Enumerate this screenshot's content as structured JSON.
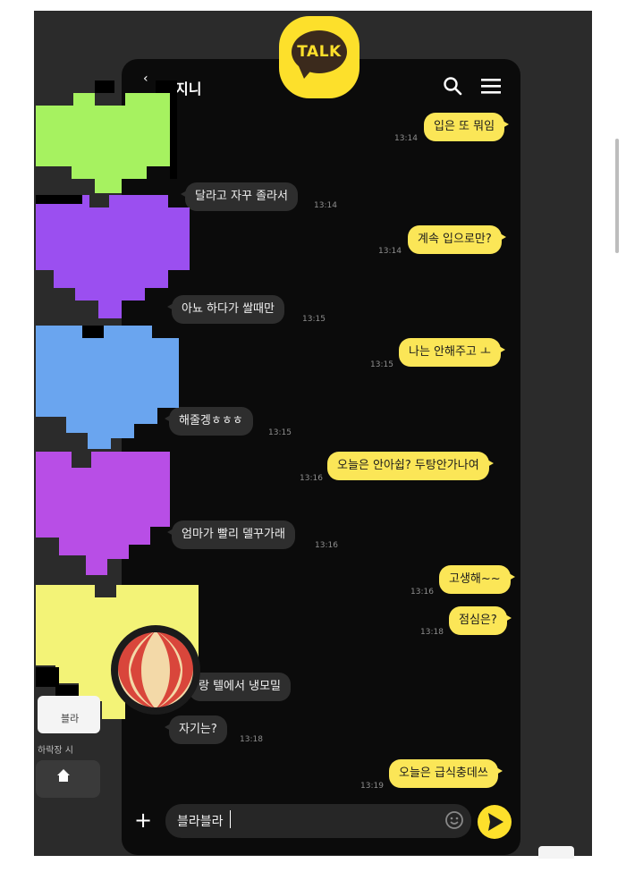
{
  "header": {
    "title": "지니",
    "back_icon": "back-arrow-icon",
    "search_icon": "search-icon",
    "menu_icon": "hamburger-menu-icon"
  },
  "logo": {
    "text": "TALK",
    "color": "#fde02b"
  },
  "messages": [
    {
      "id": "m1",
      "side": "me",
      "text": "입은 또 뭐임",
      "time": "13:14"
    },
    {
      "id": "m2",
      "side": "other",
      "text": "달라고 자꾸 졸라서",
      "time": "13:14"
    },
    {
      "id": "m3",
      "side": "me",
      "text": "계속 입으로만?",
      "time": "13:14"
    },
    {
      "id": "m4",
      "side": "other",
      "text": "아뇨 하다가 쌀때만",
      "time": "13:15"
    },
    {
      "id": "m5",
      "side": "me",
      "text": "나는 안해주고 ㅗ",
      "time": "13:15"
    },
    {
      "id": "m6",
      "side": "other",
      "text": "해줄겡ㅎㅎㅎ",
      "time": "13:15"
    },
    {
      "id": "m7",
      "side": "me",
      "text": "오늘은 안아쉽? 두탕안가나여",
      "time": "13:16"
    },
    {
      "id": "m8",
      "side": "other",
      "text": "엄마가 빨리 델꾸가래",
      "time": "13:16"
    },
    {
      "id": "m9",
      "side": "me",
      "text": "고생해~~",
      "time": "13:16"
    },
    {
      "id": "m10",
      "side": "me",
      "text": "점심은?",
      "time": "13:18"
    },
    {
      "id": "m11",
      "side": "other",
      "text": "랑 텔에서 냉모밀",
      "time": ""
    },
    {
      "id": "m12",
      "side": "other",
      "text": "자기는?",
      "time": "13:18"
    },
    {
      "id": "m13",
      "side": "me",
      "text": "오늘은 급식충데쓰",
      "time": "13:19"
    }
  ],
  "input": {
    "value": "블라블라"
  },
  "bottom_left": {
    "card_label": "블라",
    "caption": "하락장 시",
    "home_icon": "home-icon"
  },
  "colors": {
    "my_bubble": "#fbe657",
    "other_bubble": "#2e2e2e",
    "background": "#0b0b0b"
  }
}
